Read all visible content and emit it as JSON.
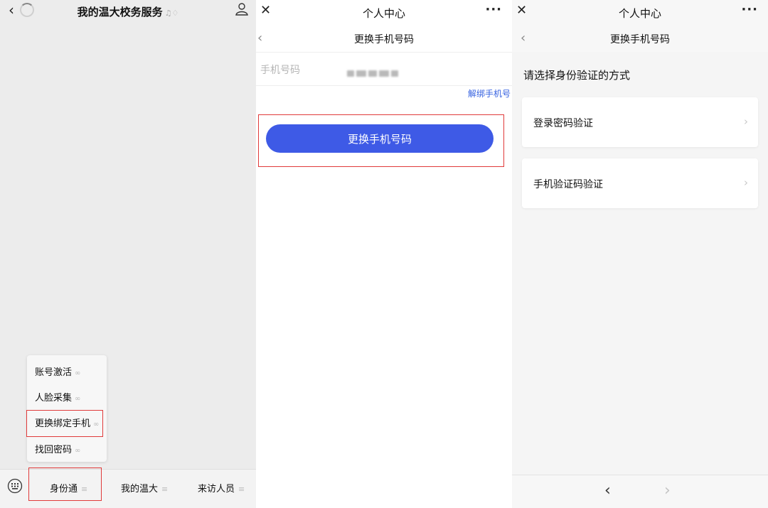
{
  "panel1": {
    "title": "我的温大校务服务",
    "back_icon": "chevron-left-icon",
    "menu_items": [
      {
        "label": "账号激活"
      },
      {
        "label": "人脸采集"
      },
      {
        "label": "更换绑定手机"
      },
      {
        "label": "找回密码"
      }
    ],
    "tabs": [
      {
        "label": "身份通"
      },
      {
        "label": "我的温大"
      },
      {
        "label": "来访人员"
      }
    ],
    "highlight_color": "#e03a3a"
  },
  "panel2": {
    "window_title": "个人中心",
    "more_label": "···",
    "close_label": "✕",
    "page_title": "更换手机号码",
    "phone_label": "手机号码",
    "unbind_label": "解绑手机号",
    "change_button_label": "更换手机号码",
    "accent_color": "#3e5ae6"
  },
  "panel3": {
    "window_title": "个人中心",
    "more_label": "···",
    "close_label": "✕",
    "page_title": "更换手机号码",
    "prompt": "请选择身份验证的方式",
    "options": [
      {
        "label": "登录密码验证"
      },
      {
        "label": "手机验证码验证"
      }
    ],
    "nav_back_label": "‹",
    "nav_forward_label": "›"
  }
}
